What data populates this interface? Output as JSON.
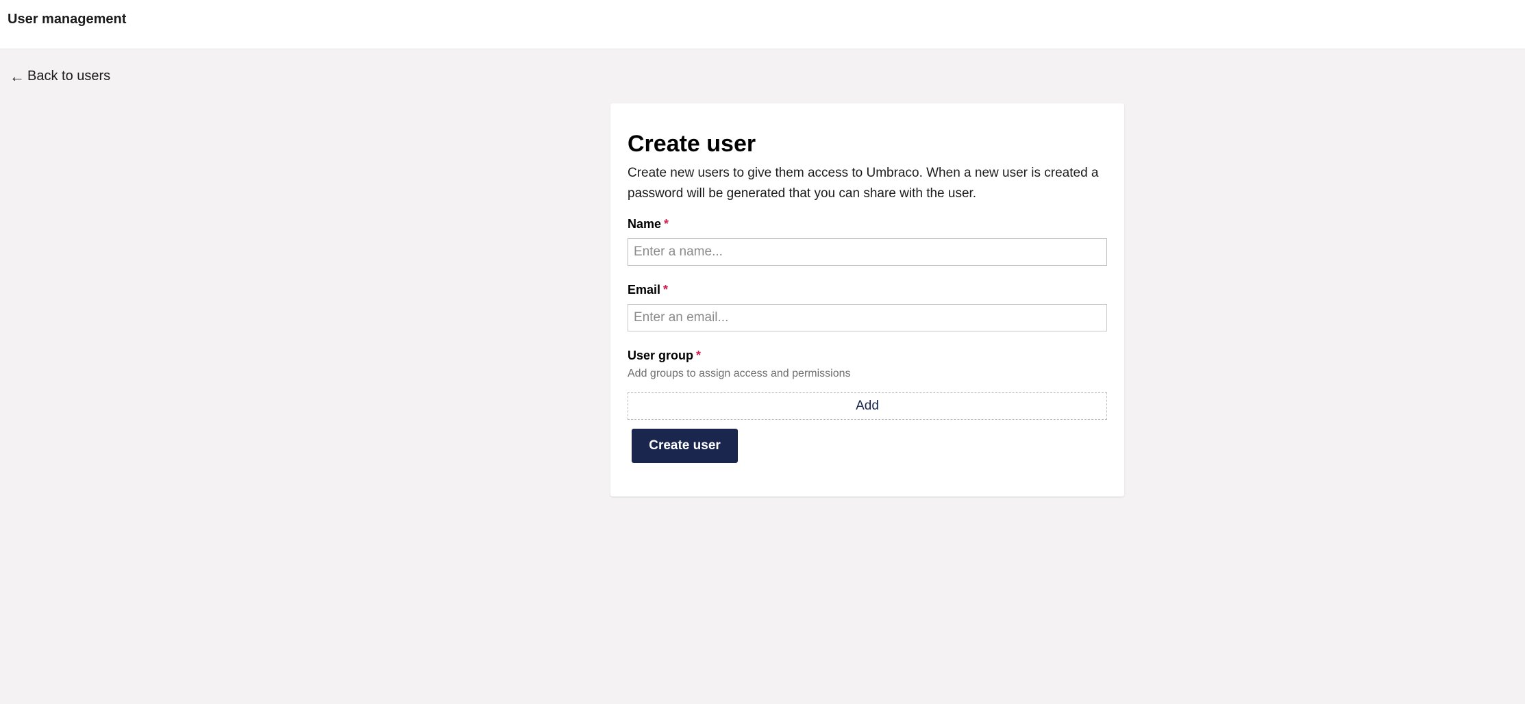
{
  "header": {
    "title": "User management"
  },
  "nav": {
    "back_arrow": "←",
    "back_label": "Back to users"
  },
  "form": {
    "title": "Create user",
    "description": "Create new users to give them access to Umbraco. When a new user is created a password will be generated that you can share with the user.",
    "required_marker": "*",
    "name": {
      "label": "Name",
      "value": "",
      "placeholder": "Enter a name..."
    },
    "email": {
      "label": "Email",
      "value": "",
      "placeholder": "Enter an email..."
    },
    "user_group": {
      "label": "User group",
      "help": "Add groups to assign access and permissions",
      "add_label": "Add"
    },
    "submit_label": "Create user"
  },
  "colors": {
    "primary": "#1b264f",
    "required": "#d42054",
    "background": "#f4f2f3"
  },
  "icons": {
    "back": "arrow-left-icon"
  }
}
